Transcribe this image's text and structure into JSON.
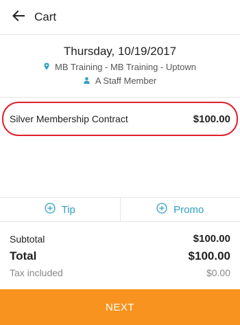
{
  "header": {
    "title": "Cart"
  },
  "appointment": {
    "date": "Thursday, 10/19/2017",
    "location": "MB Training - MB Training - Uptown",
    "staff": "A Staff Member"
  },
  "cart_items": [
    {
      "name": "Silver Membership Contract",
      "price": "$100.00"
    }
  ],
  "actions": {
    "tip_label": "Tip",
    "promo_label": "Promo"
  },
  "totals": {
    "subtotal_label": "Subtotal",
    "subtotal_value": "$100.00",
    "total_label": "Total",
    "total_value": "$100.00",
    "tax_label": "Tax included",
    "tax_value": "$0.00"
  },
  "footer": {
    "next_label": "NEXT"
  },
  "colors": {
    "accent": "#2f9fc4",
    "primary_button": "#f7931e",
    "highlight": "#e0202b"
  },
  "icons": {
    "back": "arrow-left-icon",
    "location": "map-pin-icon",
    "staff": "person-icon",
    "add": "plus-circle-icon"
  }
}
